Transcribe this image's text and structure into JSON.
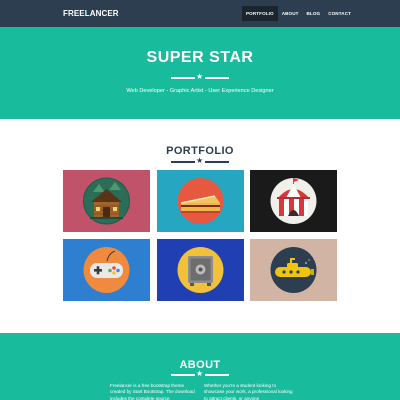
{
  "navbar": {
    "brand": "FREELANCER",
    "items": [
      {
        "label": "PORTFOLIO",
        "active": true
      },
      {
        "label": "ABOUT",
        "active": false
      },
      {
        "label": "BLOG",
        "active": false
      },
      {
        "label": "CONTACT",
        "active": false
      }
    ]
  },
  "hero": {
    "title": "SUPER STAR",
    "subtitle": "Web Developer - Graphic Artist - User Experience Designer"
  },
  "portfolio": {
    "title": "PORTFOLIO",
    "items": [
      {
        "icon": "cabin-icon",
        "bg": "#c0526a"
      },
      {
        "icon": "cake-icon",
        "bg": "#27a6c2"
      },
      {
        "icon": "circus-tent-icon",
        "bg": "#1a1a1a"
      },
      {
        "icon": "game-controller-icon",
        "bg": "#2f7fd0"
      },
      {
        "icon": "safe-icon",
        "bg": "#1f3fb3"
      },
      {
        "icon": "submarine-icon",
        "bg": "#d2b4a4"
      }
    ]
  },
  "about": {
    "title": "ABOUT",
    "col1": "Freelancer is a free bootstrap theme created by Start Bootstrap. The download includes the complete source",
    "col2": "Whether you're a student looking to showcase your work, a professional looking to attract clients, or anyone"
  },
  "colors": {
    "primary": "#2c3e50",
    "accent": "#18bc9c",
    "nav_active": "#1a252f"
  }
}
